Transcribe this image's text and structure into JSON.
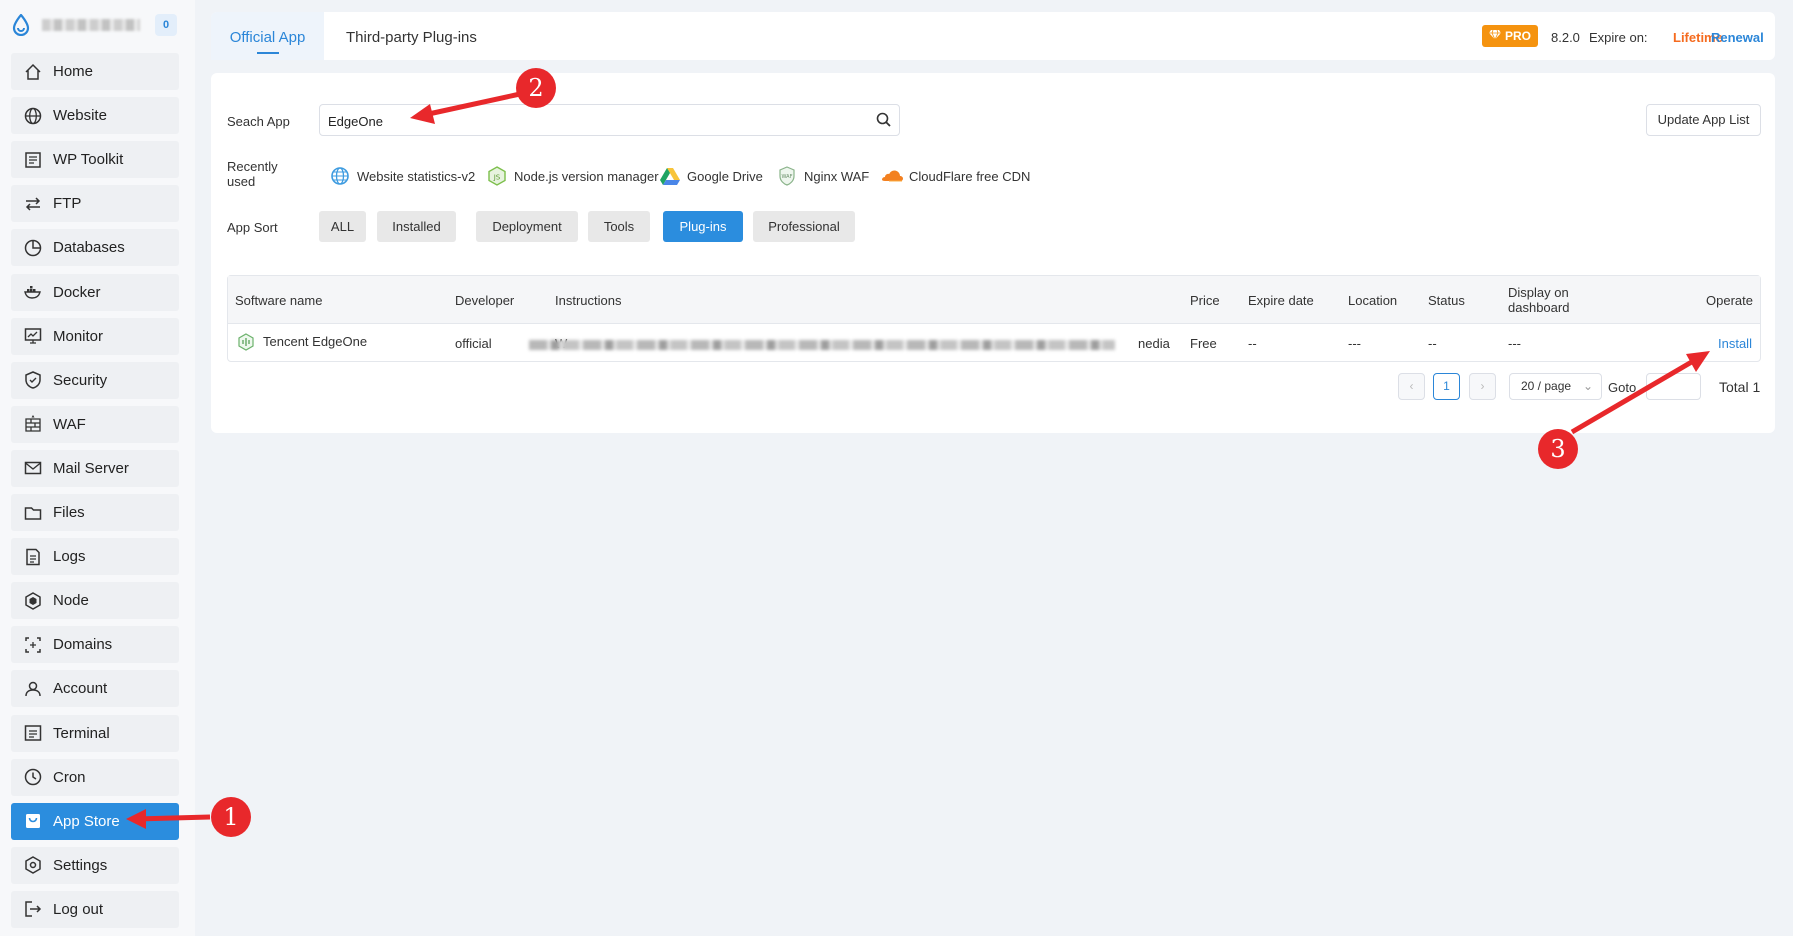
{
  "sidebar": {
    "badge": "0",
    "items": [
      {
        "label": "Home",
        "icon": "home-icon"
      },
      {
        "label": "Website",
        "icon": "globe-icon"
      },
      {
        "label": "WP Toolkit",
        "icon": "wordpress-icon"
      },
      {
        "label": "FTP",
        "icon": "transfer-icon"
      },
      {
        "label": "Databases",
        "icon": "database-icon"
      },
      {
        "label": "Docker",
        "icon": "docker-icon"
      },
      {
        "label": "Monitor",
        "icon": "monitor-icon"
      },
      {
        "label": "Security",
        "icon": "shield-icon"
      },
      {
        "label": "WAF",
        "icon": "firewall-icon"
      },
      {
        "label": "Mail Server",
        "icon": "mail-icon"
      },
      {
        "label": "Files",
        "icon": "folder-icon"
      },
      {
        "label": "Logs",
        "icon": "log-icon"
      },
      {
        "label": "Node",
        "icon": "node-icon"
      },
      {
        "label": "Domains",
        "icon": "domain-icon"
      },
      {
        "label": "Account",
        "icon": "user-icon"
      },
      {
        "label": "Terminal",
        "icon": "terminal-icon"
      },
      {
        "label": "Cron",
        "icon": "clock-icon"
      },
      {
        "label": "App Store",
        "icon": "store-icon",
        "active": true
      },
      {
        "label": "Settings",
        "icon": "settings-icon"
      },
      {
        "label": "Log out",
        "icon": "logout-icon"
      }
    ]
  },
  "header": {
    "tabs": [
      "Official App",
      "Third-party Plug-ins"
    ],
    "pro_label": "PRO",
    "version": "8.2.0",
    "expire_label": "Expire on:",
    "expire_value": "Lifetime",
    "renewal": "Renewal"
  },
  "search": {
    "label": "Seach App",
    "value": "EdgeOne",
    "update_button": "Update App List"
  },
  "recent": {
    "label": "Recently used",
    "items": [
      {
        "name": "Website statistics-v2",
        "icon": "statistics-icon"
      },
      {
        "name": "Node.js version manager",
        "icon": "nodejs-icon"
      },
      {
        "name": "Google Drive",
        "icon": "google-drive-icon"
      },
      {
        "name": "Nginx WAF",
        "icon": "waf-icon"
      },
      {
        "name": "CloudFlare free CDN",
        "icon": "cloudflare-icon"
      }
    ]
  },
  "sort": {
    "label": "App Sort",
    "options": [
      "ALL",
      "Installed",
      "Deployment",
      "Tools",
      "Plug-ins",
      "Professional"
    ],
    "selected": "Plug-ins"
  },
  "table": {
    "headers": [
      "Software name",
      "Developer",
      "Instructions",
      "Price",
      "Expire date",
      "Location",
      "Status",
      "Display on dashboard",
      "Operate"
    ],
    "rows": [
      {
        "name": "Tencent EdgeOne",
        "developer": "official",
        "instructions_start": "W",
        "instructions_end": "nedia",
        "price": "Free",
        "expire": "--",
        "location": "---",
        "status": "--",
        "display": "---",
        "operate": "Install"
      }
    ]
  },
  "pagination": {
    "prev": "‹",
    "page": "1",
    "next": "›",
    "per_page": "20 / page",
    "goto": "Goto",
    "total": "Total 1"
  },
  "annotations": [
    "1",
    "2",
    "3"
  ],
  "colors": {
    "accent": "#2b8dde",
    "pro": "#f5930f",
    "lifetime": "#f56b1f",
    "annotation": "#e8282b"
  }
}
